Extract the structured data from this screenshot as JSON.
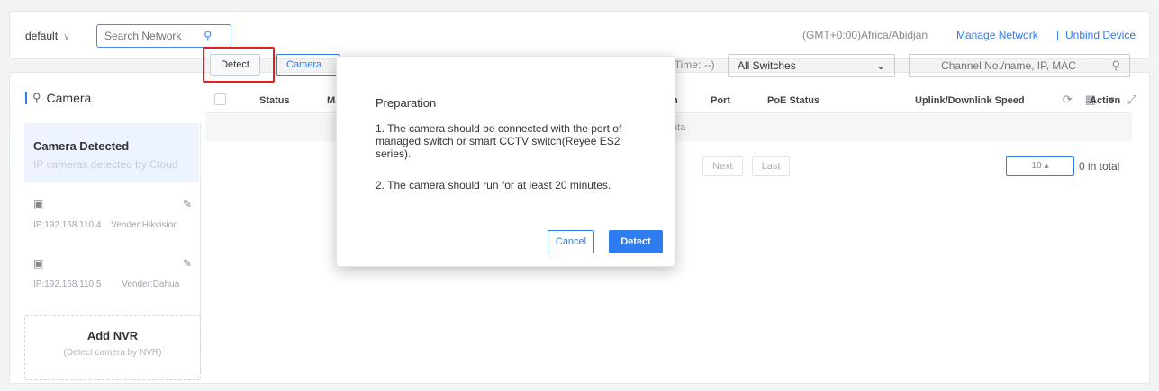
{
  "header": {
    "network": "default",
    "search_placeholder": "Search Network",
    "timezone": "(GMT+0:00)Africa/Abidjan",
    "manage_network": "Manage Network",
    "separator": "|",
    "unbind_device": "Unbind Device"
  },
  "panel": {
    "title": "Camera",
    "toolbar_icons": [
      "refresh-icon",
      "grid-icon",
      "chevron-down-icon",
      "expand-icon"
    ]
  },
  "sidebar": {
    "active_title": "Camera Detected",
    "active_subtitle": "IP cameras detected by Cloud",
    "cameras": [
      {
        "ip": "IP:192.168.110.4",
        "vendor": "Vender:Hikvision"
      },
      {
        "ip": "IP:192.168.110.5",
        "vendor": "Vender:Dahua"
      }
    ],
    "add_nvr_title": "Add NVR",
    "add_nvr_sub": "(Detect camera by NVR)"
  },
  "toolbar": {
    "detect": "Detect",
    "camera_btn": "Camera",
    "update_time": "ate Time: --)",
    "switch_filter": "All Switches",
    "channel_placeholder": "Channel No./name, IP, MAC"
  },
  "table": {
    "columns": [
      "Status",
      "MA",
      "h",
      "Port",
      "PoE Status",
      "Uplink/Downlink Speed",
      "Action"
    ],
    "empty": "Data"
  },
  "pagination": {
    "next": "Next",
    "last": "Last",
    "page_size": "10",
    "total": "0 in total"
  },
  "modal": {
    "title": "Preparation",
    "point1": "1. The camera should be connected with the port of managed switch or smart CCTV switch(Reyee ES2 series).",
    "point2": "2. The camera should run for at least 20 minutes.",
    "cancel": "Cancel",
    "detect": "Detect"
  },
  "colors": {
    "accent": "#2f7bf0",
    "highlight": "#e02020"
  }
}
